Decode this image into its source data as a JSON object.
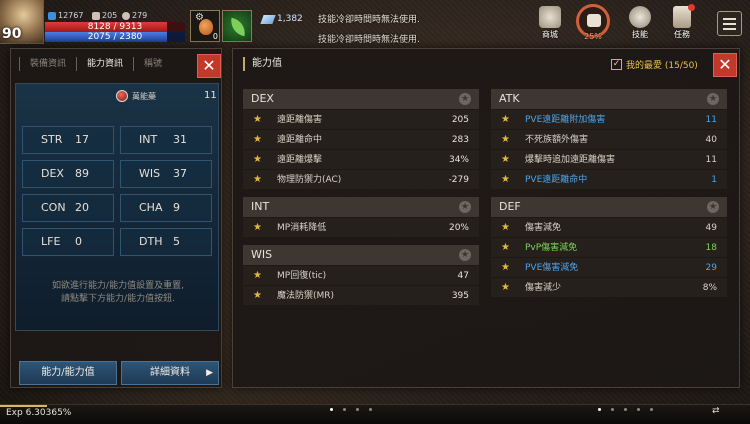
{
  "hud": {
    "level": "90",
    "currency": [
      {
        "value": "12767",
        "color": "#3b8fe0",
        "icon": "blue-gem-icon"
      },
      {
        "value": "205",
        "color": "#c9c2b5",
        "icon": "cross-swords-icon"
      },
      {
        "value": "279",
        "color": "#c9c2b5",
        "icon": "skull-icon"
      }
    ],
    "hp": "8128 / 9313",
    "mp": "2075 / 2380",
    "hp_fraction": 0.873,
    "mp_fraction": 0.872,
    "potion_qty": "0",
    "crystal": "1,382",
    "system_msg_1": "技能冷卻時間時無法使用.",
    "system_msg_2": "技能冷卻時間時無法使用.",
    "buttons": [
      {
        "label": "商城",
        "icon": "shop-icon"
      },
      {
        "label": "25%",
        "icon": "fist-icon"
      },
      {
        "label": "技能",
        "icon": "skill-icon"
      },
      {
        "label": "任務",
        "icon": "quest-icon"
      }
    ]
  },
  "left": {
    "tabs": [
      "裝備資訊",
      "能力資訊",
      "稱號"
    ],
    "active_tab": 1,
    "elixir_label": "萬能藥",
    "elixir_count": "11",
    "stats": [
      {
        "name": "STR",
        "value": "17"
      },
      {
        "name": "INT",
        "value": "31"
      },
      {
        "name": "DEX",
        "value": "89"
      },
      {
        "name": "WIS",
        "value": "37"
      },
      {
        "name": "CON",
        "value": "20"
      },
      {
        "name": "CHA",
        "value": "9"
      },
      {
        "name": "LFE",
        "value": "0"
      },
      {
        "name": "DTH",
        "value": "5"
      }
    ],
    "hint_line1": "如欲進行能力/能力值設置及重置,",
    "hint_line2": "請點擊下方能力/能力值按鈕.",
    "btn_stats": "能力/能力值",
    "btn_detail": "詳細資料"
  },
  "right": {
    "title": "能力值",
    "fav_label": "我的最愛 (15/50)",
    "sections": {
      "dex": {
        "title": "DEX",
        "rows": [
          {
            "label": "遠距離傷害",
            "value": "205"
          },
          {
            "label": "遠距離命中",
            "value": "283"
          },
          {
            "label": "遠距離爆擊",
            "value": "34%"
          },
          {
            "label": "物理防禦力(AC)",
            "value": "-279"
          }
        ]
      },
      "int": {
        "title": "INT",
        "rows": [
          {
            "label": "MP消耗降低",
            "value": "20%"
          }
        ]
      },
      "wis": {
        "title": "WIS",
        "rows": [
          {
            "label": "MP回復(tic)",
            "value": "47"
          },
          {
            "label": "魔法防禦(MR)",
            "value": "395"
          }
        ]
      },
      "atk": {
        "title": "ATK",
        "rows": [
          {
            "label": "PVE遠距離附加傷害",
            "value": "11",
            "color": "#4fa3e8"
          },
          {
            "label": "不死族額外傷害",
            "value": "40",
            "color": "#d8d2c6"
          },
          {
            "label": "爆擊時追加遠距離傷害",
            "value": "11",
            "color": "#d8d2c6"
          },
          {
            "label": "PVE遠距離命中",
            "value": "1",
            "color": "#4fa3e8"
          }
        ]
      },
      "def": {
        "title": "DEF",
        "rows": [
          {
            "label": "傷害減免",
            "value": "49",
            "color": "#d8d2c6"
          },
          {
            "label": "PvP傷害減免",
            "value": "18",
            "color": "#7ed35a"
          },
          {
            "label": "PVE傷害減免",
            "value": "29",
            "color": "#4fa3e8"
          },
          {
            "label": "傷害減少",
            "value": "8%",
            "color": "#d8d2c6"
          }
        ]
      }
    }
  },
  "bottom": {
    "exp": "Exp 6.30365%",
    "exp_fraction": 0.063
  },
  "colors": {
    "accent_gold": "#e6b83a",
    "close_red": "#c0392b",
    "pve_blue": "#4fa3e8",
    "pvp_green": "#7ed35a"
  }
}
